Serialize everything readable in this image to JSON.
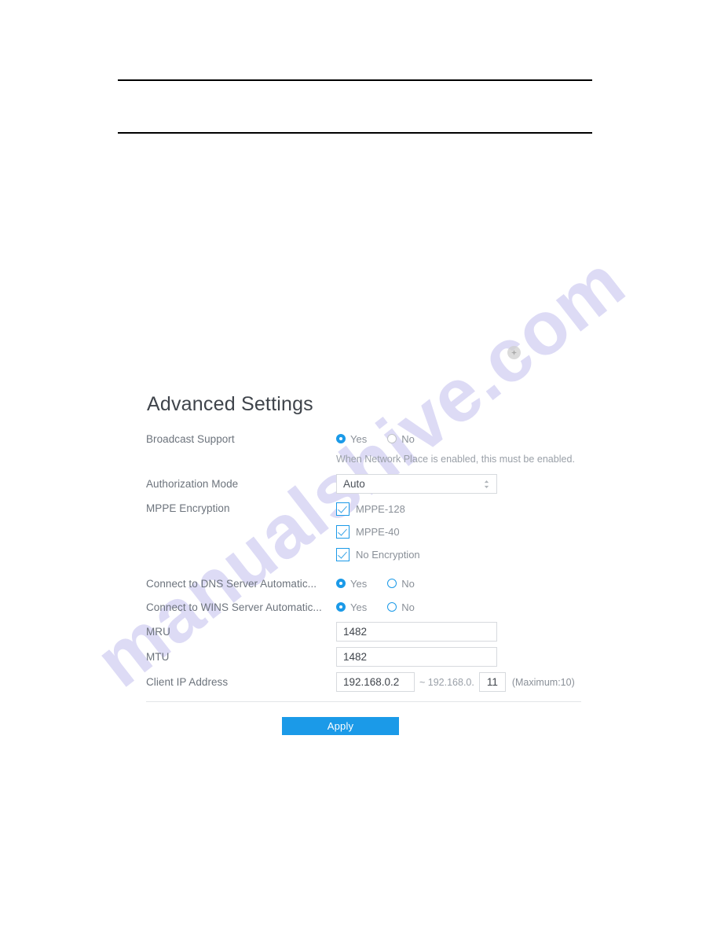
{
  "page": {
    "watermark": "manualshive.com",
    "badge_icon": "asterisk-badge-icon"
  },
  "panel": {
    "title": "Advanced Settings",
    "rows": {
      "broadcast_support": {
        "label": "Broadcast Support",
        "yes": "Yes",
        "no": "No",
        "selected": "Yes",
        "hint": "When Network Place is enabled, this must be enabled."
      },
      "authorization_mode": {
        "label": "Authorization Mode",
        "value": "Auto"
      },
      "mppe_encryption": {
        "label": "MPPE Encryption",
        "options": [
          {
            "label": "MPPE-128",
            "checked": true
          },
          {
            "label": "MPPE-40",
            "checked": true
          },
          {
            "label": "No Encryption",
            "checked": true
          }
        ]
      },
      "dns_auto": {
        "label": "Connect to DNS Server Automatic...",
        "yes": "Yes",
        "no": "No",
        "selected": "Yes"
      },
      "wins_auto": {
        "label": "Connect to WINS Server Automatic...",
        "yes": "Yes",
        "no": "No",
        "selected": "Yes"
      },
      "mru": {
        "label": "MRU",
        "value": "1482"
      },
      "mtu": {
        "label": "MTU",
        "value": "1482"
      },
      "client_ip": {
        "label": "Client IP Address",
        "start_value": "192.168.0.2",
        "separator": "~  192.168.0.",
        "end_value": "11",
        "maximum": "(Maximum:10)"
      }
    },
    "apply_label": "Apply"
  },
  "colors": {
    "accent": "#1b9ae8",
    "label_text": "#6c737c",
    "muted_text": "#9aa0a8",
    "watermark": "#c9c6f0"
  }
}
